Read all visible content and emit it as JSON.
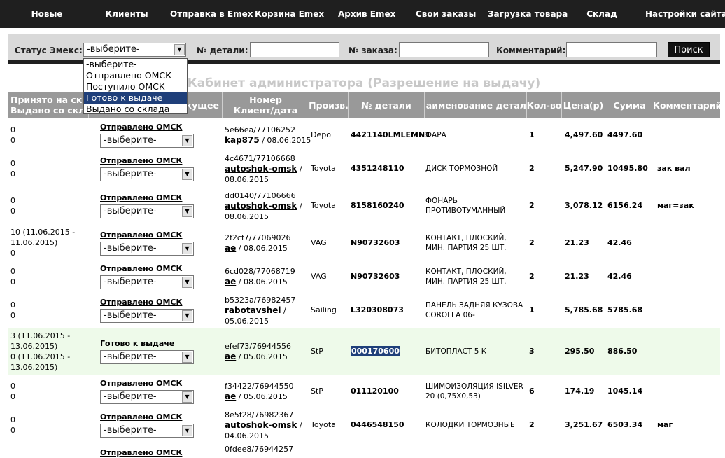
{
  "nav": {
    "items": [
      "Новые",
      "Клиенты",
      "Отправка в Emex",
      "Корзина Emex",
      "Архив Emex",
      "Свои заказы",
      "Загрузка товара",
      "Склад",
      "Настройки сайта"
    ]
  },
  "filter": {
    "status_label": "Статус Эмекс:",
    "status_value": "-выберите-",
    "part_label": "№ детали:",
    "order_label": "№ заказа:",
    "comment_label": "Комментарий:",
    "search_button": "Поиск"
  },
  "dropdown": {
    "options": [
      "-выберите-",
      "Отправлено ОМСК",
      "Поступило ОМСК",
      "Готово к выдаче",
      "Выдано со склада"
    ],
    "highlighted": "Готово к выдаче"
  },
  "page_title": "Кабинет администратора (Разрешение на выдачу)",
  "table": {
    "headers": {
      "received": "Принято на скла",
      "issued": "Выдано со скла",
      "current": "екущее",
      "number_top": "Номер",
      "number_bottom": "Клиент/дата",
      "brand": "Произв.",
      "part": "№ детали",
      "name": "Наименование детали",
      "qty": "Кол-во",
      "price": "Цена(р)",
      "sum": "Сумма",
      "comment": "Комментарий"
    },
    "select_default": "-выберите-",
    "rows": [
      {
        "dates": [
          "0",
          "0"
        ],
        "status": "Отправлено ОМСК",
        "num": "5e66ea/77106252",
        "client": "kap875",
        "date_sep": " / 08.06.2015",
        "date2": "",
        "brand": "Depo",
        "part": "4421140LMLEMN1",
        "name": "ФАРА",
        "qty": "1",
        "price": "4,497.60",
        "sum": "4497.60",
        "comment": ""
      },
      {
        "dates": [
          "0",
          "0"
        ],
        "status": "Отправлено ОМСК",
        "num": "4c4671/77106668",
        "client": "autoshok-omsk",
        "date_sep": " /",
        "date2": "08.06.2015",
        "brand": "Toyota",
        "part": "4351248110",
        "name": "ДИСК ТОРМОЗНОЙ",
        "qty": "2",
        "price": "5,247.90",
        "sum": "10495.80",
        "comment": "зак вал"
      },
      {
        "dates": [
          "0",
          "0"
        ],
        "status": "Отправлено ОМСК",
        "num": "dd0140/77106666",
        "client": "autoshok-omsk",
        "date_sep": " /",
        "date2": "08.06.2015",
        "brand": "Toyota",
        "part": "8158160240",
        "name": "ФОНАРЬ ПРОТИВОТУМАННЫЙ",
        "qty": "2",
        "price": "3,078.12",
        "sum": "6156.24",
        "comment": "маг=зак"
      },
      {
        "dates": [
          "10 (11.06.2015 -",
          "11.06.2015)",
          "0"
        ],
        "status": "Отправлено ОМСК",
        "num": "2f2cf7/77069026",
        "client": "ae",
        "date_sep": " / 08.06.2015",
        "date2": "",
        "brand": "VAG",
        "part": "N90732603",
        "name": "КОНТАКТ, ПЛОСКИЙ, МИН. ПАРТИЯ 25 ШТ.",
        "qty": "2",
        "price": "21.23",
        "sum": "42.46",
        "comment": ""
      },
      {
        "dates": [
          "0",
          "0"
        ],
        "status": "Отправлено ОМСК",
        "num": "6cd028/77068719",
        "client": "ae",
        "date_sep": " / 08.06.2015",
        "date2": "",
        "brand": "VAG",
        "part": "N90732603",
        "name": "КОНТАКТ, ПЛОСКИЙ, МИН. ПАРТИЯ 25 ШТ.",
        "qty": "2",
        "price": "21.23",
        "sum": "42.46",
        "comment": ""
      },
      {
        "dates": [
          "0",
          "0"
        ],
        "status": "Отправлено ОМСК",
        "num": "b5323a/76982457",
        "client": "rabotavshel",
        "date_sep": " /",
        "date2": "05.06.2015",
        "brand": "Sailing",
        "part": "L320308073",
        "name": "ПАНЕЛЬ ЗАДНЯЯ КУЗОВА COROLLA 06-",
        "qty": "1",
        "price": "5,785.68",
        "sum": "5785.68",
        "comment": ""
      },
      {
        "dates": [
          "3 (11.06.2015 -",
          "13.06.2015)",
          "0 (11.06.2015 -",
          "13.06.2015)"
        ],
        "status": "Готово к выдаче",
        "num": "efef73/76944556",
        "client": "ae",
        "date_sep": " / 05.06.2015",
        "date2": "",
        "brand": "StP",
        "part": "000170600",
        "name": "БИТОПЛАСТ 5 К",
        "qty": "3",
        "price": "295.50",
        "sum": "886.50",
        "comment": ""
      },
      {
        "dates": [
          "0",
          "0"
        ],
        "status": "Отправлено ОМСК",
        "num": "f34422/76944550",
        "client": "ae",
        "date_sep": " / 05.06.2015",
        "date2": "",
        "brand": "StP",
        "part": "011120100",
        "name": "ШИМОИЗОЛЯЦИЯ ISILVER 20 (0,75X0,53)",
        "qty": "6",
        "price": "174.19",
        "sum": "1045.14",
        "comment": ""
      },
      {
        "dates": [
          "0",
          "0"
        ],
        "status": "Отправлено ОМСК",
        "num": "8e5f28/76982367",
        "client": "autoshok-omsk",
        "date_sep": " /",
        "date2": "04.06.2015",
        "brand": "Toyota",
        "part": "0446548150",
        "name": "КОЛОДКИ ТОРМОЗНЫЕ",
        "qty": "2",
        "price": "3,251.67",
        "sum": "6503.34",
        "comment": "маг"
      },
      {
        "dates": [],
        "status": "Отправлено ОМСК",
        "num": "0fdee8/76944257",
        "client": "",
        "date_sep": "",
        "date2": "",
        "brand": "",
        "part": "",
        "name": "",
        "qty": "",
        "price": "",
        "sum": "",
        "comment": ""
      }
    ]
  },
  "colors": {
    "nav_bg": "#1f1f1f",
    "header_bg": "#999999",
    "highlight_row": "#eefaea",
    "selection": "#1f3f7a"
  }
}
